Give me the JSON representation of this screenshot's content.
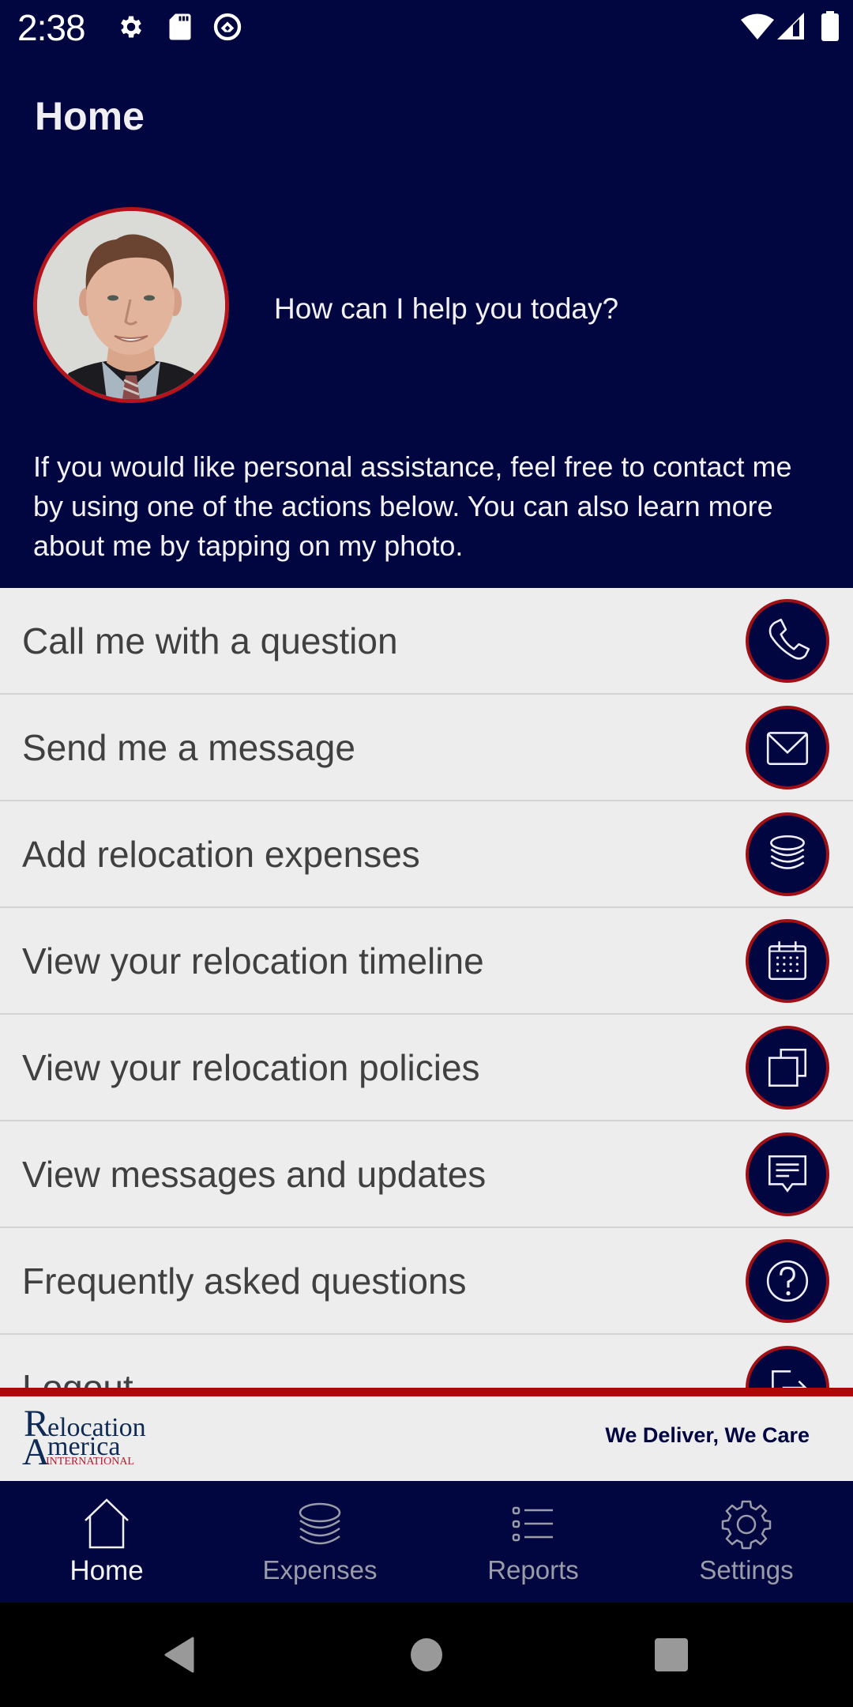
{
  "status_bar": {
    "time": "2:38",
    "left_icons": [
      "gear-icon",
      "sd-card-icon",
      "vpn-key-icon"
    ],
    "right_icons": [
      "wifi-icon",
      "cell-signal-icon",
      "battery-icon"
    ]
  },
  "header": {
    "title": "Home",
    "help_prompt": "How can I help you today?",
    "intro": "If you would like personal assistance, feel free to contact me by using one of the actions below. You can also learn more about me by tapping on my photo."
  },
  "actions": [
    {
      "label": "Call me with a question",
      "icon": "phone-icon"
    },
    {
      "label": "Send me a message",
      "icon": "envelope-icon"
    },
    {
      "label": "Add relocation expenses",
      "icon": "coin-stack-icon"
    },
    {
      "label": "View your relocation timeline",
      "icon": "calendar-icon"
    },
    {
      "label": "View your relocation policies",
      "icon": "documents-icon"
    },
    {
      "label": "View messages and updates",
      "icon": "message-icon"
    },
    {
      "label": "Frequently asked questions",
      "icon": "question-icon"
    },
    {
      "label": "Logout",
      "icon": "logout-icon"
    }
  ],
  "brand": {
    "logo_line1": "Relocation",
    "logo_line2": "America",
    "logo_line3": "INTERNATIONAL",
    "tagline": "We Deliver, We Care"
  },
  "bottom_nav": [
    {
      "label": "Home",
      "icon": "home-icon",
      "active": true
    },
    {
      "label": "Expenses",
      "icon": "coin-stack-icon",
      "active": false
    },
    {
      "label": "Reports",
      "icon": "list-icon",
      "active": false
    },
    {
      "label": "Settings",
      "icon": "gear-outline-icon",
      "active": false
    }
  ],
  "colors": {
    "navy": "#020640",
    "accent_red": "#ad0808",
    "list_bg": "#ededed",
    "text_dark": "#404040",
    "nav_inactive": "#9a9ca8"
  }
}
